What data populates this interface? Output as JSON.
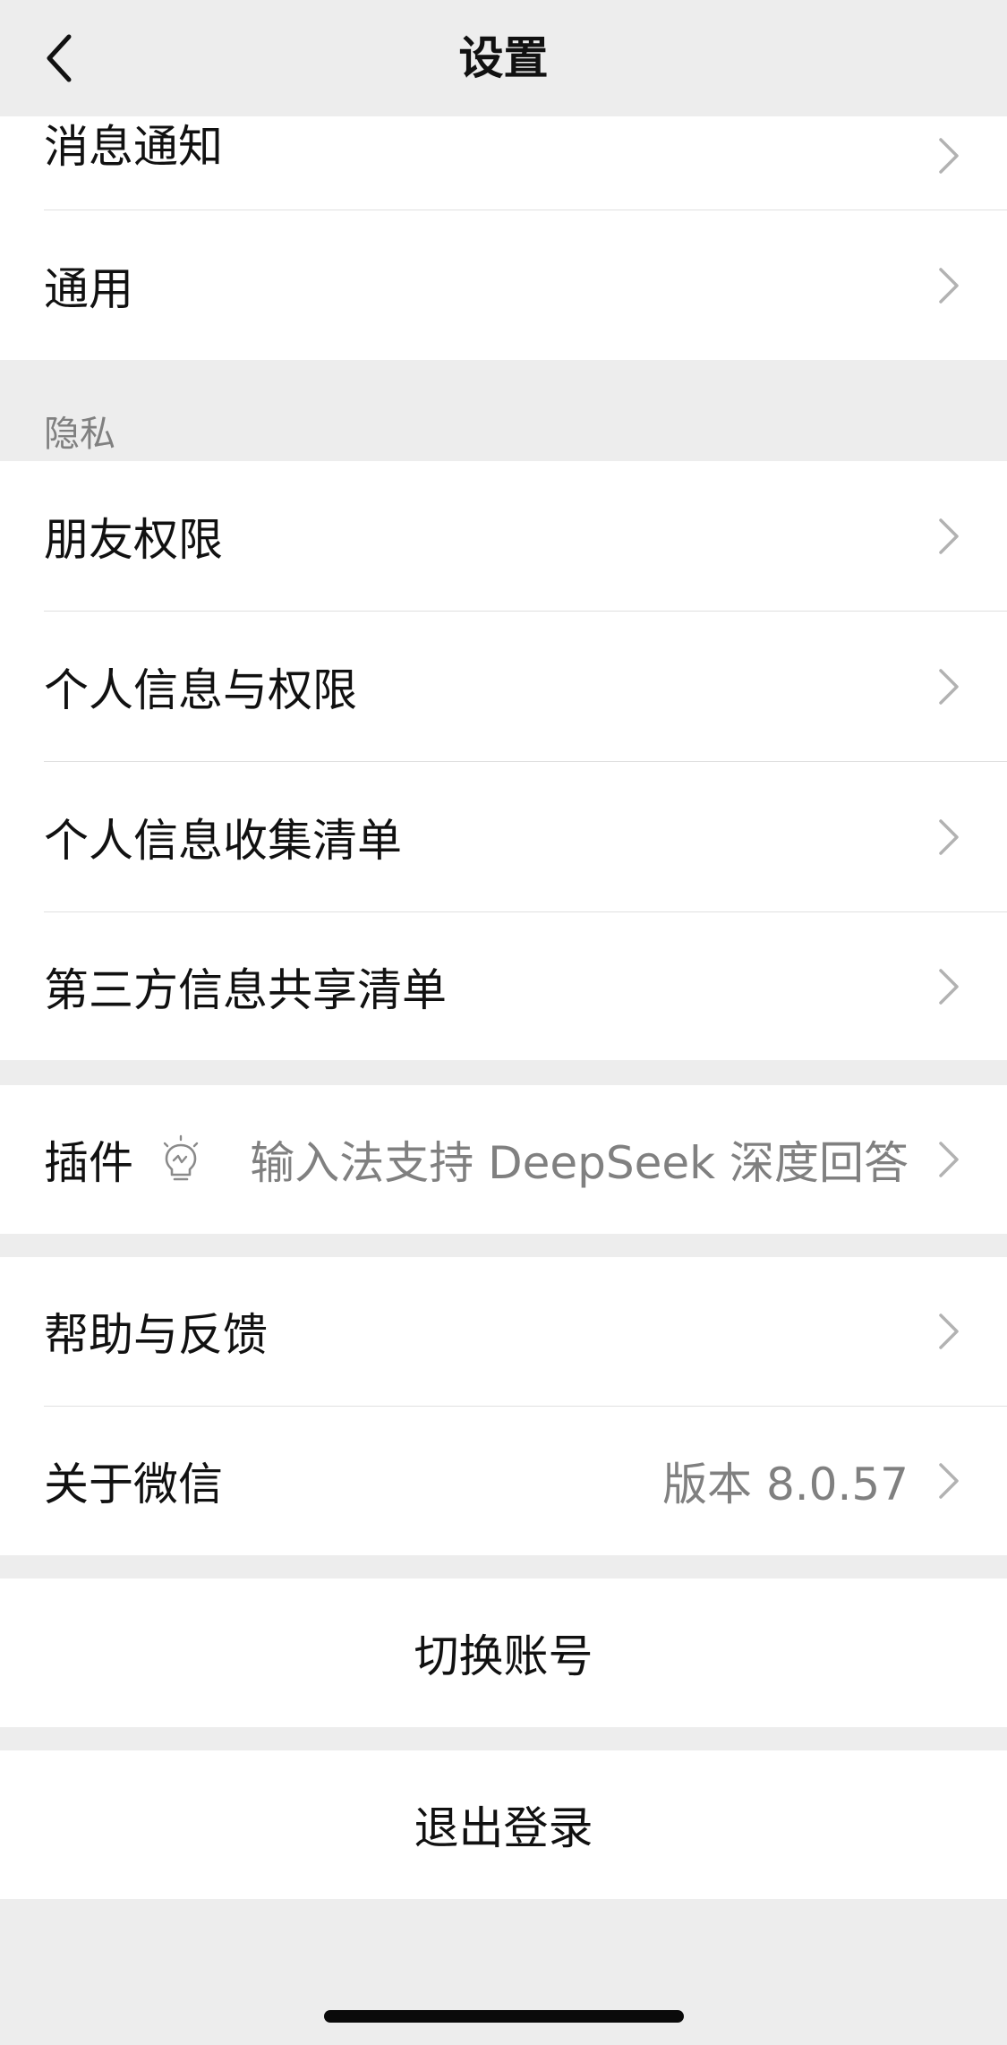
{
  "nav": {
    "title": "设置",
    "back_icon": "chevron-left-icon"
  },
  "group_top": {
    "items": [
      {
        "label": "消息通知"
      },
      {
        "label": "通用"
      }
    ]
  },
  "privacy": {
    "header": "隐私",
    "items": [
      {
        "label": "朋友权限"
      },
      {
        "label": "个人信息与权限"
      },
      {
        "label": "个人信息收集清单"
      },
      {
        "label": "第三方信息共享清单"
      }
    ]
  },
  "plugins": {
    "label": "插件",
    "icon": "lightbulb-icon",
    "value": "输入法支持 DeepSeek 深度回答"
  },
  "support": {
    "items": [
      {
        "label": "帮助与反馈",
        "value": ""
      },
      {
        "label": "关于微信",
        "value": "版本 8.0.57"
      }
    ]
  },
  "account": {
    "switch_label": "切换账号",
    "logout_label": "退出登录"
  },
  "colors": {
    "background": "#ededed",
    "cell": "#ffffff",
    "text": "#111111",
    "secondary_text": "#808080",
    "chevron": "#b2b2b2"
  }
}
